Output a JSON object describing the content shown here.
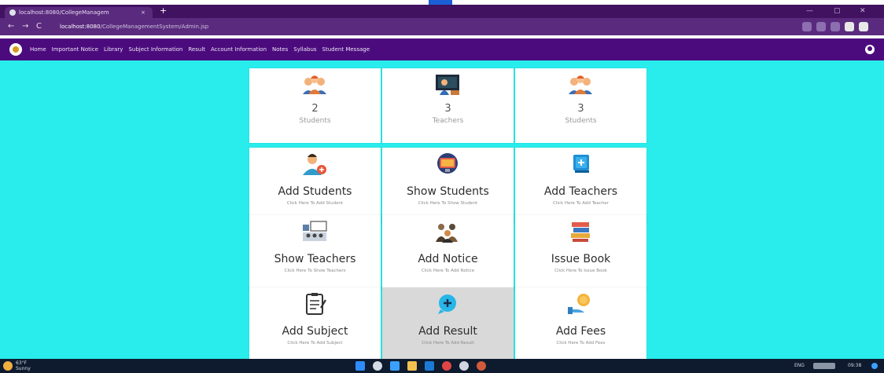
{
  "browser": {
    "tab_title": "localhost:8080/CollegeManagem",
    "tab_close": "×",
    "new_tab": "+",
    "minimize": "—",
    "maximize": "▢",
    "close": "✕",
    "back": "←",
    "forward": "→",
    "reload": "C",
    "url_host": "localhost:8080",
    "url_path": "/CollegeManagementSystem/Admin.jsp"
  },
  "navbar": {
    "items": [
      "Home",
      "Important Notice",
      "Library",
      "Subject Information",
      "Result",
      "Account Information",
      "Notes",
      "Syllabus",
      "Student Message"
    ]
  },
  "stats": [
    {
      "value": "2",
      "label": "Students",
      "icon": "students-icon"
    },
    {
      "value": "3",
      "label": "Teachers",
      "icon": "teacher-icon"
    },
    {
      "value": "3",
      "label": "Students",
      "icon": "students-icon"
    }
  ],
  "actions": [
    {
      "title": "Add Students",
      "hint": "Click Here To Add Student",
      "icon": "add-student-icon"
    },
    {
      "title": "Show Students",
      "hint": "Click Here To Show Student",
      "icon": "monitor-icon"
    },
    {
      "title": "Add Teachers",
      "hint": "Click Here To Add Teacher",
      "icon": "add-icon"
    },
    {
      "title": "Show Teachers",
      "hint": "Click Here To Show Teachers",
      "icon": "classroom-icon"
    },
    {
      "title": "Add Notice",
      "hint": "Click Here To Add Notice",
      "icon": "notice-icon"
    },
    {
      "title": "Issue Book",
      "hint": "Click Here To Issue Book",
      "icon": "books-icon"
    },
    {
      "title": "Add Subject",
      "hint": "Click Here To Add Subject",
      "icon": "clipboard-icon"
    },
    {
      "title": "Add Result",
      "hint": "Click Here To Add Result",
      "icon": "chat-plus-icon"
    },
    {
      "title": "Add Fees",
      "hint": "Click Here To Add Fees",
      "icon": "coin-hand-icon"
    }
  ],
  "taskbar": {
    "weather_temp": "63°F",
    "weather_desc": "Sunny",
    "lang": "ENG",
    "time": "09:38"
  },
  "colors": {
    "background": "#29ecec",
    "navbar": "#4b0b7d",
    "card": "#ffffff",
    "card_active": "#d9d9d9"
  }
}
